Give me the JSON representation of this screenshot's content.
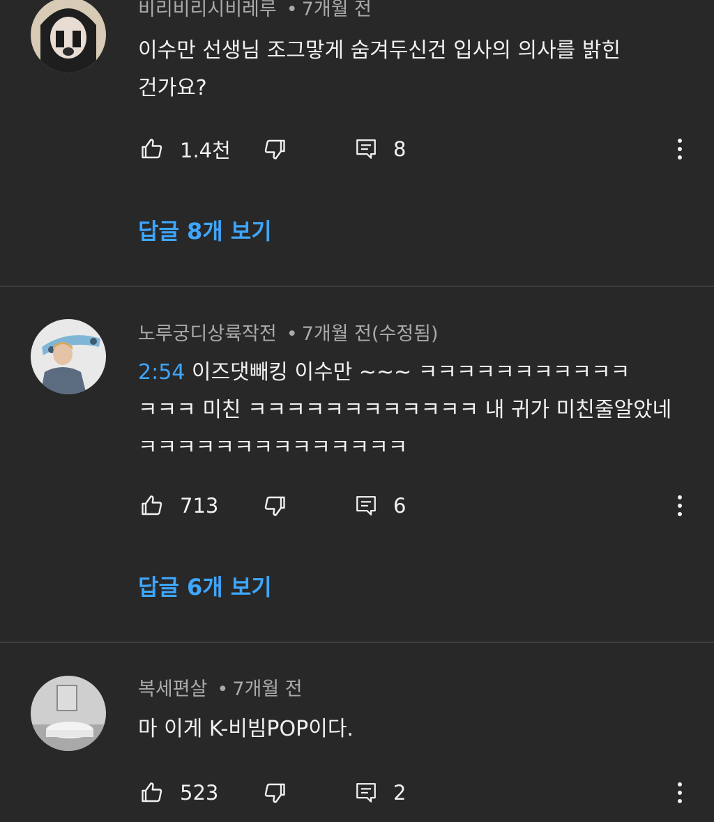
{
  "comments": [
    {
      "author": "비리비리시비레루",
      "age": "7개월 전",
      "text_lines": [
        "이수만 선생님 조그맣게 숨겨두신건 입사의 의사를 밝힌",
        "건가요?"
      ],
      "likes": "1.4천",
      "reply_count": "8",
      "view_replies": "답글 8개 보기",
      "avatar_icon": "masked-face-avatar"
    },
    {
      "author": "노루궁디상륙작전",
      "age": "7개월 전(수정됨)",
      "timestamp_link": "2:54",
      "text_lines": [
        " 이즈댓빼킹 이수만 ~~~ ㅋㅋㅋㅋㅋㅋㅋㅋㅋㅋㅋ",
        "ㅋㅋㅋ 미친 ㅋㅋㅋㅋㅋㅋㅋㅋㅋㅋㅋㅋ 내 귀가 미친줄알았네",
        "ㅋㅋㅋㅋㅋㅋㅋㅋㅋㅋㅋㅋㅋㅋ"
      ],
      "likes": "713",
      "reply_count": "6",
      "view_replies": "답글 6개 보기",
      "avatar_icon": "person-with-skateboard-avatar"
    },
    {
      "author": "복세편살",
      "age": "7개월 전",
      "text_lines": [
        "마 이게 K-비빔POP이다."
      ],
      "likes": "523",
      "reply_count": "2",
      "avatar_icon": "room-interior-avatar"
    }
  ],
  "icons": {
    "like": "thumbs-up-icon",
    "dislike": "thumbs-down-icon",
    "reply": "comment-icon",
    "more": "more-vertical-icon"
  },
  "colors": {
    "background": "#282828",
    "link": "#3ea6ff",
    "secondary_text": "#aaaaaa",
    "primary_text": "#f1f1f1"
  }
}
